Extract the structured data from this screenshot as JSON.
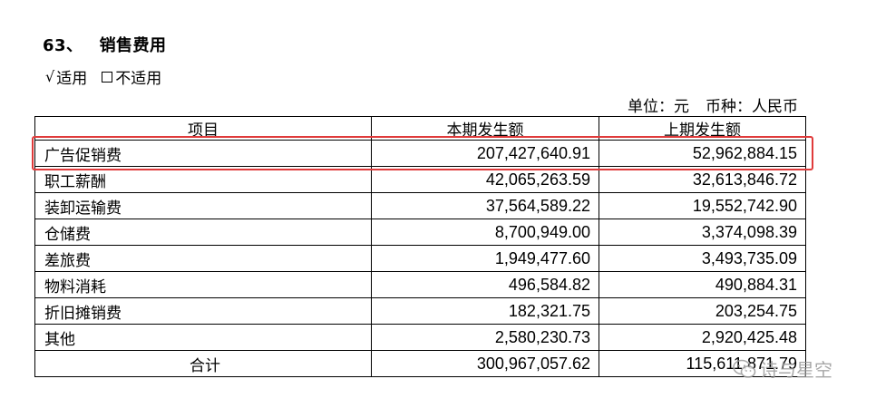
{
  "section": {
    "number": "63、",
    "title": "销售费用"
  },
  "applicability": {
    "check_mark": "√",
    "applicable": "适用",
    "not_applicable": "不适用"
  },
  "unit_line": {
    "unit": "单位：元",
    "currency": "币种：人民币"
  },
  "table": {
    "headers": [
      "项目",
      "本期发生额",
      "上期发生额"
    ],
    "rows": [
      {
        "item": "广告促销费",
        "current": "207,427,640.91",
        "previous": "52,962,884.15"
      },
      {
        "item": "职工薪酬",
        "current": "42,065,263.59",
        "previous": "32,613,846.72"
      },
      {
        "item": "装卸运输费",
        "current": "37,564,589.22",
        "previous": "19,552,742.90"
      },
      {
        "item": "仓储费",
        "current": "8,700,949.00",
        "previous": "3,374,098.39"
      },
      {
        "item": "差旅费",
        "current": "1,949,477.60",
        "previous": "3,493,735.09"
      },
      {
        "item": "物料消耗",
        "current": "496,584.82",
        "previous": "490,884.31"
      },
      {
        "item": "折旧摊销费",
        "current": "182,321.75",
        "previous": "203,254.75"
      },
      {
        "item": "其他",
        "current": "2,580,230.73",
        "previous": "2,920,425.48"
      }
    ],
    "total": {
      "item": "合计",
      "current": "300,967,057.62",
      "previous": "115,611,871.79"
    }
  },
  "highlight_color": "#e03b3b",
  "watermark": {
    "icon": "wechat-icon",
    "text": "诗与星空"
  }
}
